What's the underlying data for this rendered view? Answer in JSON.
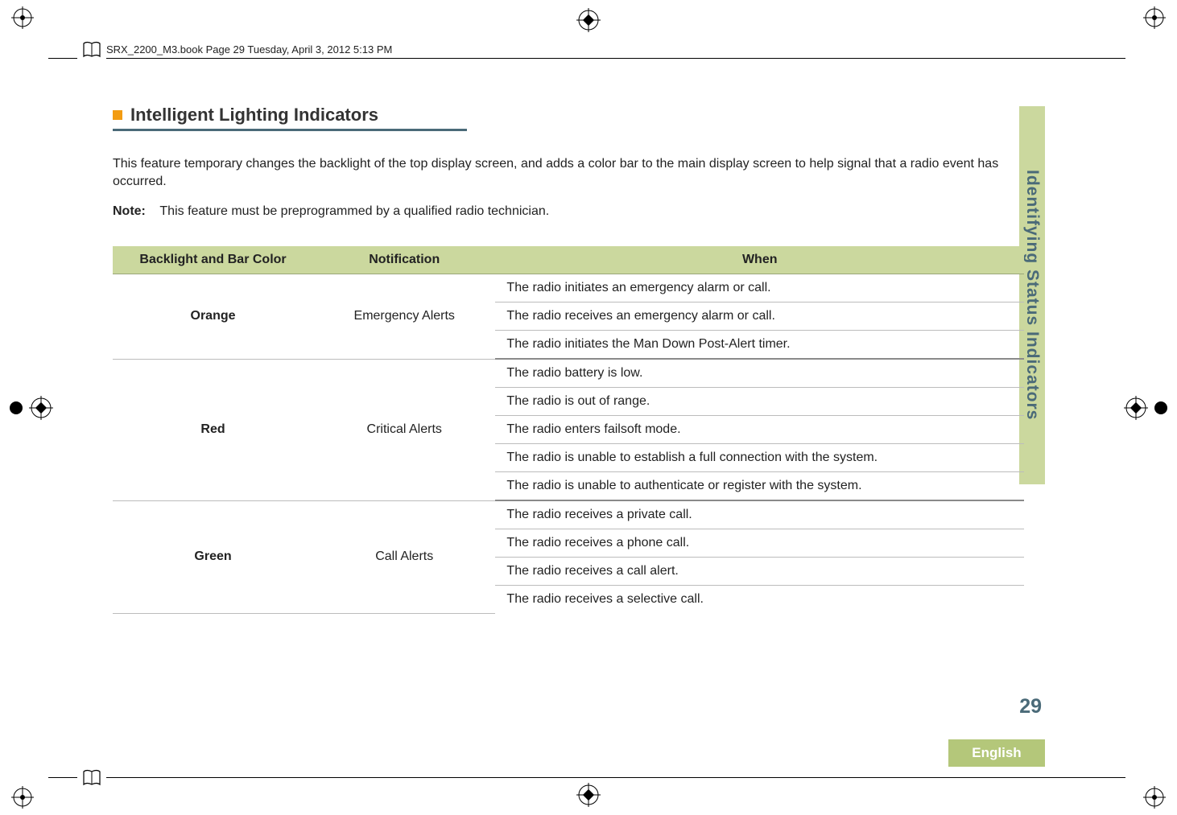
{
  "header": {
    "running_head": "SRX_2200_M3.book  Page 29  Tuesday, April 3, 2012  5:13 PM"
  },
  "section": {
    "title": "Intelligent Lighting Indicators",
    "intro": "This feature temporary changes the backlight of the top display screen, and adds a color bar to the main display screen to help signal that a radio event has occurred.",
    "note_label": "Note:",
    "note_text": "This feature must be preprogrammed by a qualified radio technician."
  },
  "table": {
    "headers": {
      "col1": "Backlight and Bar Color",
      "col2": "Notification",
      "col3": "When"
    },
    "groups": [
      {
        "color": "Orange",
        "notification": "Emergency Alerts",
        "whens": [
          "The radio initiates an emergency alarm or call.",
          "The radio receives an emergency alarm or call.",
          "The radio initiates the Man Down Post-Alert timer."
        ]
      },
      {
        "color": "Red",
        "notification": "Critical Alerts",
        "whens": [
          "The radio battery is low.",
          "The radio is out of range.",
          "The radio enters failsoft mode.",
          "The radio is unable to establish a full connection with the system.",
          "The radio is unable to authenticate or register with the system."
        ]
      },
      {
        "color": "Green",
        "notification": "Call Alerts",
        "whens": [
          "The radio receives a private call.",
          "The radio receives a phone call.",
          "The radio receives a call alert.",
          "The radio receives a selective call."
        ]
      }
    ]
  },
  "side": {
    "tab_label": "Identifying Status Indicators",
    "page_number": "29",
    "language": "English"
  }
}
